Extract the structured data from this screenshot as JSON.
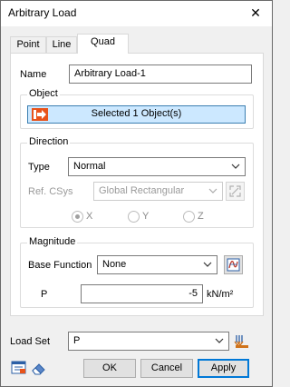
{
  "window": {
    "title": "Arbitrary Load"
  },
  "tabs": [
    {
      "label": "Point"
    },
    {
      "label": "Line"
    },
    {
      "label": "Quad"
    }
  ],
  "name": {
    "label": "Name",
    "value": "Arbitrary Load-1"
  },
  "object": {
    "group_title": "Object",
    "button_label": "Selected 1 Object(s)"
  },
  "direction": {
    "group_title": "Direction",
    "type_label": "Type",
    "type_value": "Normal",
    "refcsys_label": "Ref. CSys",
    "refcsys_value": "Global Rectangular",
    "axes": [
      {
        "label": "X"
      },
      {
        "label": "Y"
      },
      {
        "label": "Z"
      }
    ]
  },
  "magnitude": {
    "group_title": "Magnitude",
    "base_function_label": "Base Function",
    "base_function_value": "None",
    "p_label": "P",
    "p_value": "-5",
    "p_unit": "kN/m²"
  },
  "load_set": {
    "label": "Load Set",
    "value": "P"
  },
  "buttons": {
    "ok": "OK",
    "cancel": "Cancel",
    "apply": "Apply"
  },
  "colors": {
    "selection": "#cce8ff",
    "accent": "#0078d7",
    "object_icon": "#e8531a"
  },
  "icons": {
    "object": "select-arrow-icon",
    "csys": "expand-csys-icon",
    "function": "function-editor-icon",
    "load_set": "load-set-manager-icon",
    "bottom_left_1": "table-view-icon",
    "bottom_left_2": "eraser-icon"
  }
}
